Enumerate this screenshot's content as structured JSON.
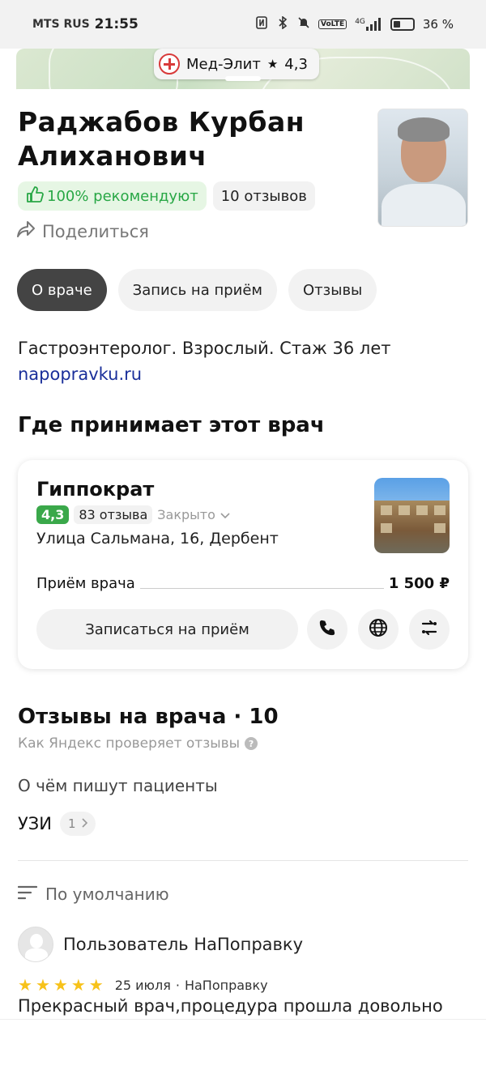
{
  "statusbar": {
    "carrier": "MTS RUS",
    "time": "21:55",
    "network": "4G",
    "volte": "VoLTE",
    "battery": "36 %",
    "battery_level": 0.36
  },
  "map": {
    "clinic_name": "Мед-Элит",
    "rating": "4,3"
  },
  "doctor": {
    "name": "Раджабов Курбан Алиханович",
    "recommend": "100% рекомендуют",
    "reviews_count": "10 отзывов",
    "share": "Поделиться",
    "specialty": "Гастроэнтеролог. Взрослый. Стаж 36 лет",
    "source": "napopravku.ru"
  },
  "tabs": [
    "О враче",
    "Запись на приём",
    "Отзывы"
  ],
  "where": {
    "title": "Где принимает этот врач",
    "clinic": {
      "name": "Гиппократ",
      "rating": "4,3",
      "reviews": "83 отзыва",
      "status": "Закрыто",
      "address": "Улица Сальмана, 16, Дербент",
      "service": "Приём врача",
      "price": "1 500 ₽",
      "book_label": "Записаться на приём"
    }
  },
  "reviews": {
    "title": "Отзывы на врача · 10",
    "check_link": "Как Яндекс проверяет отзывы",
    "topics_title": "О чём пишут пациенты",
    "topic": {
      "label": "УЗИ",
      "count": "1"
    },
    "sort_label": "По умолчанию",
    "items": [
      {
        "author": "Пользователь НаПоправку",
        "stars": 5,
        "date": "25 июля",
        "source": "НаПоправку",
        "text": "Прекрасный врач,процедура прошла довольно"
      }
    ]
  },
  "colors": {
    "accent_green": "#3aa84a",
    "link": "#1a2f9a",
    "tab_active": "#444444",
    "star": "#f7c21a"
  }
}
